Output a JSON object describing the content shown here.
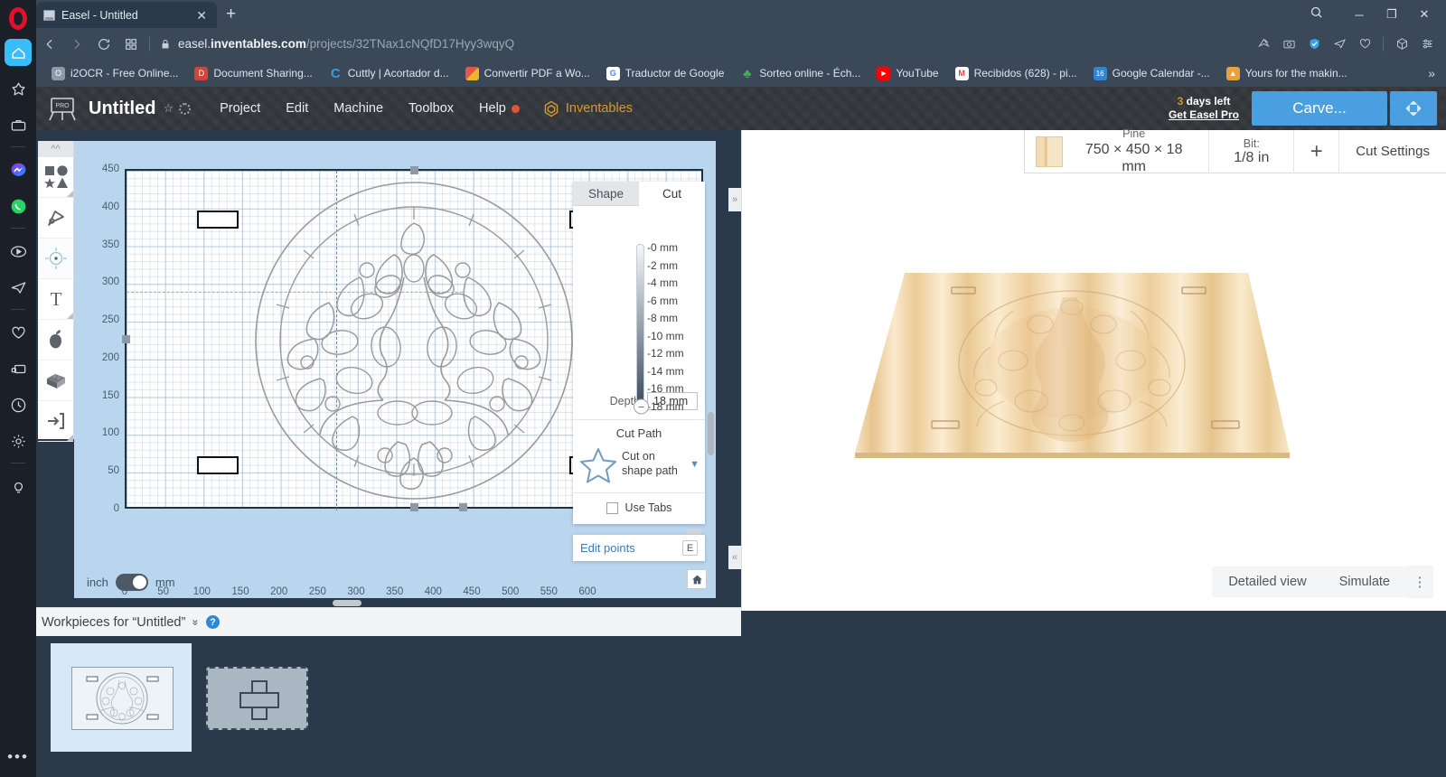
{
  "browser": {
    "tab": {
      "title": "Easel - Untitled",
      "close_label": "✕",
      "newtab_label": "+"
    },
    "window_controls": {
      "minimize": "─",
      "maximize": "❐",
      "close": "✕"
    },
    "url": {
      "host_prefix": "easel.",
      "host_bold": "inventables.com",
      "path": "/projects/32TNax1cNQfD17Hyy3wqyQ"
    },
    "bookmarks": [
      {
        "label": "i2OCR - Free Online...",
        "icon": "ocr-icon",
        "color": "#8e9aa6"
      },
      {
        "label": "Document Sharing...",
        "icon": "document-sharing-icon",
        "color": "#d4443a"
      },
      {
        "label": "Cuttly | Acortador d...",
        "icon": "cuttly-icon",
        "color": "#2f9fe0"
      },
      {
        "label": "Convertir PDF a Wo...",
        "icon": "pdf-convert-icon",
        "color": "#e2574c"
      },
      {
        "label": "Traductor de Google",
        "icon": "google-translate-icon",
        "color": "#4285f4"
      },
      {
        "label": "Sorteo online - Éch...",
        "icon": "clover-icon",
        "color": "#39b54a"
      },
      {
        "label": "YouTube",
        "icon": "youtube-icon",
        "color": "#ff0000"
      },
      {
        "label": "Recibidos (628) - pi...",
        "icon": "gmail-icon",
        "color": "#ea4335"
      },
      {
        "label": "Google Calendar -...",
        "icon": "google-calendar-icon",
        "color": "#2f86d2"
      },
      {
        "label": "Yours for the makin...",
        "icon": "inventables-icon",
        "color": "#e9a13b"
      }
    ],
    "bookmarks_overflow": "»"
  },
  "easel": {
    "logo_text": "PRO",
    "project_title": "Untitled",
    "menus": [
      "Project",
      "Edit",
      "Machine",
      "Toolbox",
      "Help"
    ],
    "inventables_label": "Inventables",
    "trial_days": "3",
    "trial_text": "days left",
    "get_pro_label": "Get Easel Pro",
    "carve_label": "Carve...",
    "material": {
      "name": "Pine",
      "dimensions": "750 × 450 × 18 mm",
      "bit_label": "Bit:",
      "bit_value": "1/8 in",
      "add_label": "+",
      "cut_settings_label": "Cut Settings"
    },
    "tools": [
      {
        "name": "shapes-tool",
        "label": "Shapes"
      },
      {
        "name": "pen-tool",
        "label": "Pen"
      },
      {
        "name": "drill-tool",
        "label": "Drill"
      },
      {
        "name": "text-tool",
        "label": "Text"
      },
      {
        "name": "apps-tool",
        "label": "Apps"
      },
      {
        "name": "3d-model-tool",
        "label": "3D"
      },
      {
        "name": "import-tool",
        "label": "Import"
      }
    ],
    "collapse_label": "«"
  },
  "canvas": {
    "y_ticks": [
      450,
      400,
      350,
      300,
      250,
      200,
      150,
      100,
      50,
      0
    ],
    "x_ticks": [
      0,
      50,
      100,
      150,
      200,
      250,
      300,
      350,
      400,
      450,
      500,
      550,
      600
    ],
    "units_left": "inch",
    "units_right": "mm",
    "units_selected": "mm",
    "home_icon": "home-icon"
  },
  "inspector": {
    "tabs": [
      {
        "label": "Shape",
        "active": false
      },
      {
        "label": "Cut",
        "active": true
      }
    ],
    "depth_scale": [
      "-0 mm",
      "-2 mm",
      "-4 mm",
      "-6 mm",
      "-8 mm",
      "-10 mm",
      "-12 mm",
      "-14 mm",
      "-16 mm",
      "-18 mm"
    ],
    "knob_label": "−",
    "depth_label": "Depth",
    "depth_value": "18 mm",
    "cut_path_title": "Cut Path",
    "cut_path_value": "Cut on shape path",
    "cut_path_icon": "star-icon",
    "use_tabs_label": "Use Tabs",
    "use_tabs_checked": false,
    "edit_points_label": "Edit points",
    "edit_points_shortcut": "E"
  },
  "preview": {
    "detailed_view_label": "Detailed view",
    "simulate_label": "Simulate",
    "kebab_label": "⋮",
    "collapse_left": "«",
    "expand_right": "»"
  },
  "workpieces": {
    "title": "Workpieces for “Untitled”",
    "chevron": "»",
    "help_label": "?",
    "items": [
      {
        "name": "workpiece-1",
        "selected": true
      },
      {
        "name": "workpiece-add",
        "selected": false
      }
    ]
  },
  "sidebar": {
    "items": [
      {
        "name": "sidebar-home-icon",
        "active": true
      },
      {
        "name": "sidebar-favorites-icon",
        "active": false
      },
      {
        "name": "sidebar-workspaces-icon",
        "active": false
      },
      {
        "name": "sidebar-messenger-icon",
        "active": false
      },
      {
        "name": "sidebar-whatsapp-icon",
        "active": false
      },
      {
        "name": "sidebar-player-icon",
        "active": false
      },
      {
        "name": "sidebar-telegram-icon",
        "active": false
      },
      {
        "name": "sidebar-pinboard-icon",
        "active": false
      },
      {
        "name": "sidebar-cast-icon",
        "active": false
      },
      {
        "name": "sidebar-history-icon",
        "active": false
      },
      {
        "name": "sidebar-settings-icon",
        "active": false
      },
      {
        "name": "sidebar-tips-icon",
        "active": false
      }
    ],
    "more_label": "•••"
  },
  "colors": {
    "accent": "#4a9fe0",
    "chrome": "#3b4857",
    "rail": "#1b2028",
    "canvas": "#b9d6ee",
    "gold": "#d79a2b"
  }
}
